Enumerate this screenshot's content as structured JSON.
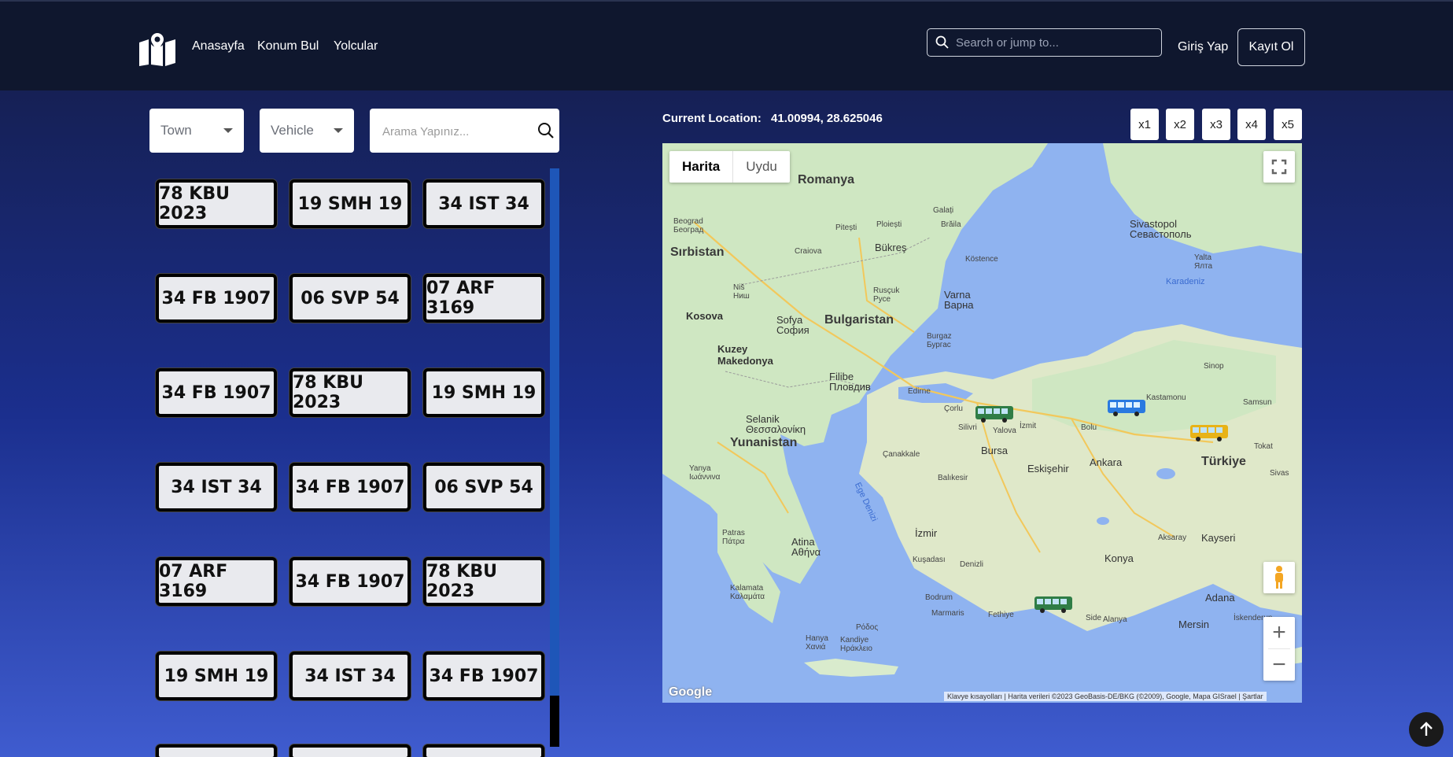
{
  "nav": {
    "links": [
      "Anasayfa",
      "Konum Bul",
      "Yolcular"
    ],
    "search_placeholder": "Search or jump to...",
    "login": "Giriş Yap",
    "register": "Kayıt Ol"
  },
  "filters": {
    "town": "Town",
    "vehicle": "Vehicle",
    "search_placeholder": "Arama Yapınız..."
  },
  "plates": [
    [
      "78 KBU 2023",
      "19 SMH 19",
      "34 IST 34"
    ],
    [
      "34 FB 1907",
      "06 SVP 54",
      "07 ARF 3169"
    ],
    [
      "34 FB 1907",
      "78 KBU 2023",
      "19 SMH 19"
    ],
    [
      "34 IST 34",
      "34 FB 1907",
      "06 SVP 54"
    ],
    [
      "07 ARF 3169",
      "34 FB 1907",
      "78 KBU 2023"
    ],
    [
      "19 SMH 19",
      "34 IST 34",
      "34 FB 1907"
    ]
  ],
  "location": {
    "label": "Current Location:",
    "coords": "41.00994, 28.625046"
  },
  "speed_buttons": [
    "x1",
    "x2",
    "x3",
    "x4",
    "x5"
  ],
  "map": {
    "type_active": "Harita",
    "type_inactive": "Uydu",
    "attribution": "Klavye kısayolları | Harita verileri ©2023 GeoBasis-DE/BKG (©2009), Google, Mapa GISrael | Şartlar",
    "google": "Google",
    "labels": {
      "romanya": "Romanya",
      "sirbistan": "Sırbistan",
      "bulgaristan": "Bulgaristan",
      "kosova": "Kosova",
      "kuzey_makedonya": "Kuzey\nMakedonya",
      "yunanistan": "Yunanistan",
      "turkiye": "Türkiye",
      "sofya": "Sofya\nСофия",
      "bukres": "Bükreş",
      "varna": "Varna\nВарна",
      "filibe": "Filibe\nПловдив",
      "sivastopol": "Sivastopol\nСевастополь",
      "karadeniz": "Karadeniz",
      "ankara": "Ankara",
      "bursa": "Bursa",
      "eskisehir": "Eskişehir",
      "izmir": "İzmir",
      "konya": "Konya",
      "kayseri": "Kayseri",
      "adana": "Adana",
      "mersin": "Mersin",
      "atina": "Atina\nΑθήνα",
      "selanik": "Selanik\nΘεσσαλονίκη",
      "kastamonu": "Kastamonu",
      "samsun": "Samsun",
      "sinop": "Sinop",
      "tokat": "Tokat",
      "sivas": "Sivas",
      "canakkale": "Çanakkale",
      "balikesir": "Balıkesir",
      "denizli": "Denizli",
      "edirne": "Edirne",
      "corlu": "Çorlu",
      "izmit": "İzmit",
      "bolu": "Bolu",
      "yalova": "Yalova",
      "silivri": "Silivri",
      "burgaz": "Burgaz\nБургас",
      "ruscuk": "Rusçuk\nРусе",
      "craiova": "Craiova",
      "pitesti": "Pitești",
      "ploiesti": "Ploiești",
      "galati": "Galați",
      "braila": "Brăila",
      "kostence": "Köstence",
      "yalta": "Yalta\nЯлта",
      "nis": "Niš\nНиш",
      "belgrad": "Beograd\nБеоград",
      "ege": "Ege Denizi",
      "aksaray": "Aksaray",
      "alanya": "Alanya",
      "side": "Side",
      "fethiye": "Fethiye",
      "bodrum": "Bodrum",
      "marmaris": "Marmaris",
      "kusadasi": "Kuşadası",
      "kalamata": "Kalamata\nΚαλαμάτα",
      "patras": "Patras\nΠάτρα",
      "yanya": "Yanya\nΙωάννινα",
      "hanya": "Hanya\nΧανιά",
      "kandiye": "Kandiye\nΗράκλειο",
      "iskenderun": "İskenderun",
      "rodos": "Ρόδος"
    }
  },
  "colors": {
    "navbar": "#0f172e",
    "plate_bg": "#e9eaee",
    "sea": "#8fb3f0",
    "land": "#cfe7c2"
  }
}
